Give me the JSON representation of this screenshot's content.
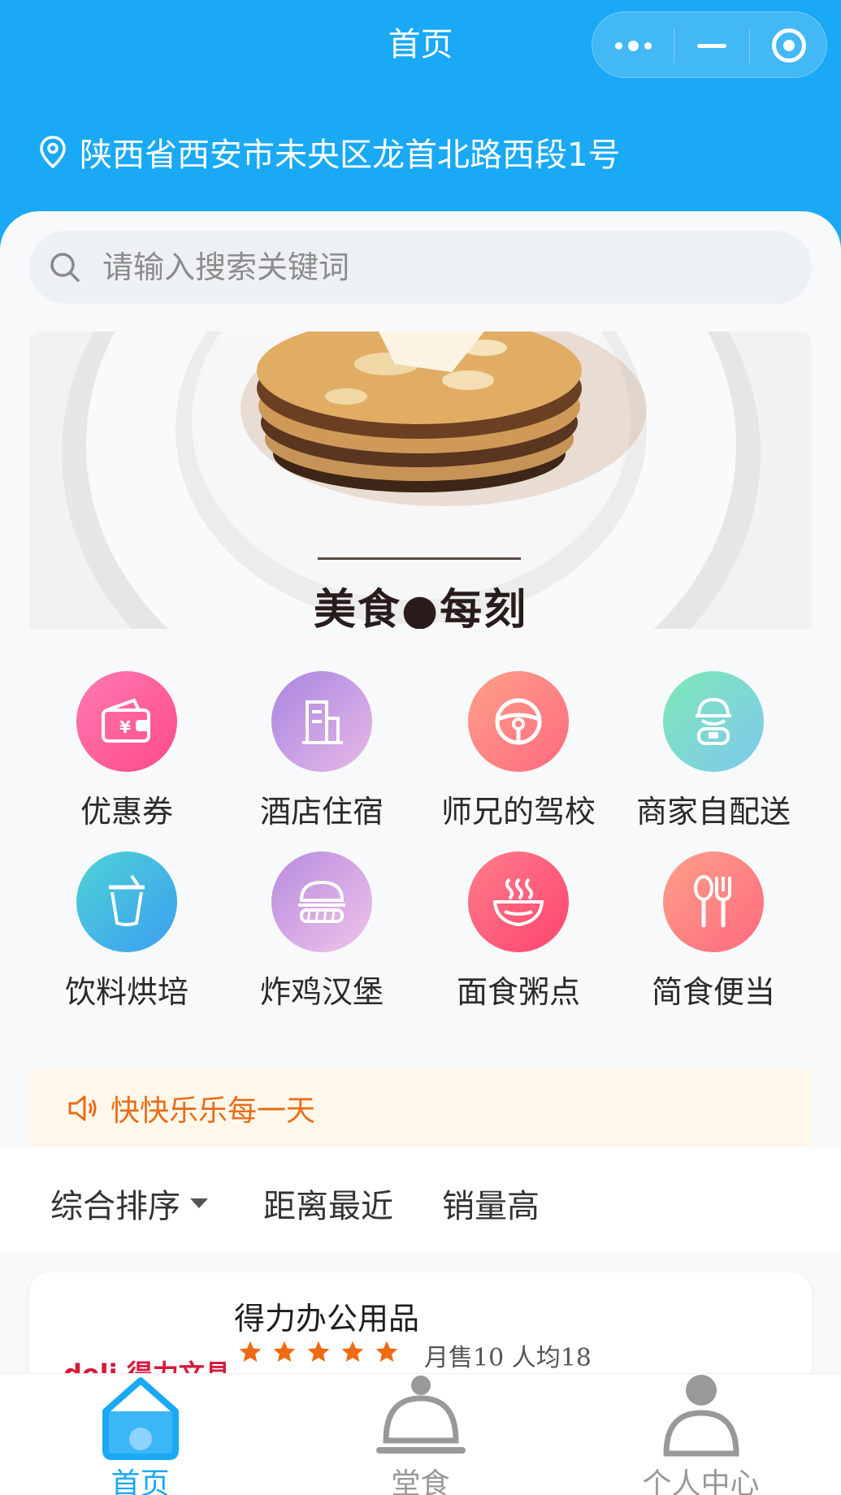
{
  "nav": {
    "title": "首页"
  },
  "location": {
    "address": "陕西省西安市未央区龙首北路西段1号"
  },
  "search": {
    "placeholder": "请输入搜索关键词"
  },
  "banner": {
    "caption": "美食●每刻"
  },
  "categories": [
    {
      "label": "优惠券",
      "icon": "wallet-coupon-icon",
      "color": "#ff5a94"
    },
    {
      "label": "酒店住宿",
      "icon": "building-icon",
      "color": "#b98be0"
    },
    {
      "label": "师兄的驾校",
      "icon": "steering-wheel-icon",
      "color": "#ff7a7a"
    },
    {
      "label": "商家自配送",
      "icon": "courier-icon",
      "color": "#5fd5c0"
    },
    {
      "label": "饮料烘培",
      "icon": "drink-cup-icon",
      "color": "#3cb6e8"
    },
    {
      "label": "炸鸡汉堡",
      "icon": "burger-icon",
      "color": "#c79be6"
    },
    {
      "label": "面食粥点",
      "icon": "noodle-bowl-icon",
      "color": "#ff5c7a"
    },
    {
      "label": "简食便当",
      "icon": "spoon-fork-icon",
      "color": "#ff7f7f"
    }
  ],
  "notice": {
    "text": "快快乐乐每一天"
  },
  "sort": {
    "option1": "综合排序",
    "option2": "距离最近",
    "option3": "销量高"
  },
  "store": {
    "name": "得力办公用品",
    "rating": 5,
    "meta": "月售10 人均18",
    "logo_text": "deli 得力文具"
  },
  "tabbar": {
    "tab1": "首页",
    "tab2": "堂食",
    "tab3": "个人中心"
  },
  "colors": {
    "primary": "#19a9f5",
    "accent": "#e96d18"
  }
}
